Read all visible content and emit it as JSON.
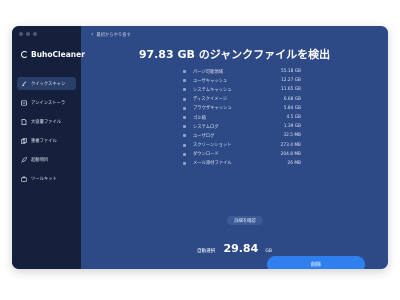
{
  "app": {
    "name": "BuhoCleaner"
  },
  "sidebar": {
    "items": [
      {
        "label": "クイックスキャン",
        "icon": "broom-icon",
        "active": true
      },
      {
        "label": "アンインストーラ",
        "icon": "uninstall-icon",
        "active": false
      },
      {
        "label": "大容量ファイル",
        "icon": "large-file-icon",
        "active": false
      },
      {
        "label": "重複ファイル",
        "icon": "duplicate-file-icon",
        "active": false
      },
      {
        "label": "起動項目",
        "icon": "rocket-icon",
        "active": false
      },
      {
        "label": "ツールキット",
        "icon": "toolkit-icon",
        "active": false
      }
    ]
  },
  "header": {
    "back_label": "最初からやり直す"
  },
  "headline": {
    "size": "97.83",
    "unit": "GB",
    "text": "のジャンクファイルを検出"
  },
  "junk_items": [
    {
      "name": "パージ可能領域",
      "size": "55.18 GB"
    },
    {
      "name": "ユーザキャッシュ",
      "size": "12.27 GB"
    },
    {
      "name": "システムキャッシュ",
      "size": "11.65 GB"
    },
    {
      "name": "ディスクイメージ",
      "size": "6.68 GB"
    },
    {
      "name": "ブラウザキャッシュ",
      "size": "5.84 GB"
    },
    {
      "name": "ゴミ箱",
      "size": "4.5 GB"
    },
    {
      "name": "システムログ",
      "size": "1.39 GB"
    },
    {
      "name": "ユーザログ",
      "size": "32.5 MB"
    },
    {
      "name": "スクリーンショット",
      "size": "273.4 MB"
    },
    {
      "name": "ダウンロード",
      "size": "204.8 MB"
    },
    {
      "name": "メール添付ファイル",
      "size": "26 MB"
    }
  ],
  "details_button": "詳細を確認",
  "selected": {
    "label": "自動選択",
    "value": "29.84",
    "unit": "GB"
  },
  "delete_button": "削除",
  "colors": {
    "sidebar_bg": "#14203c",
    "main_bg": "#2d4a86",
    "accent": "#2f80ee"
  }
}
